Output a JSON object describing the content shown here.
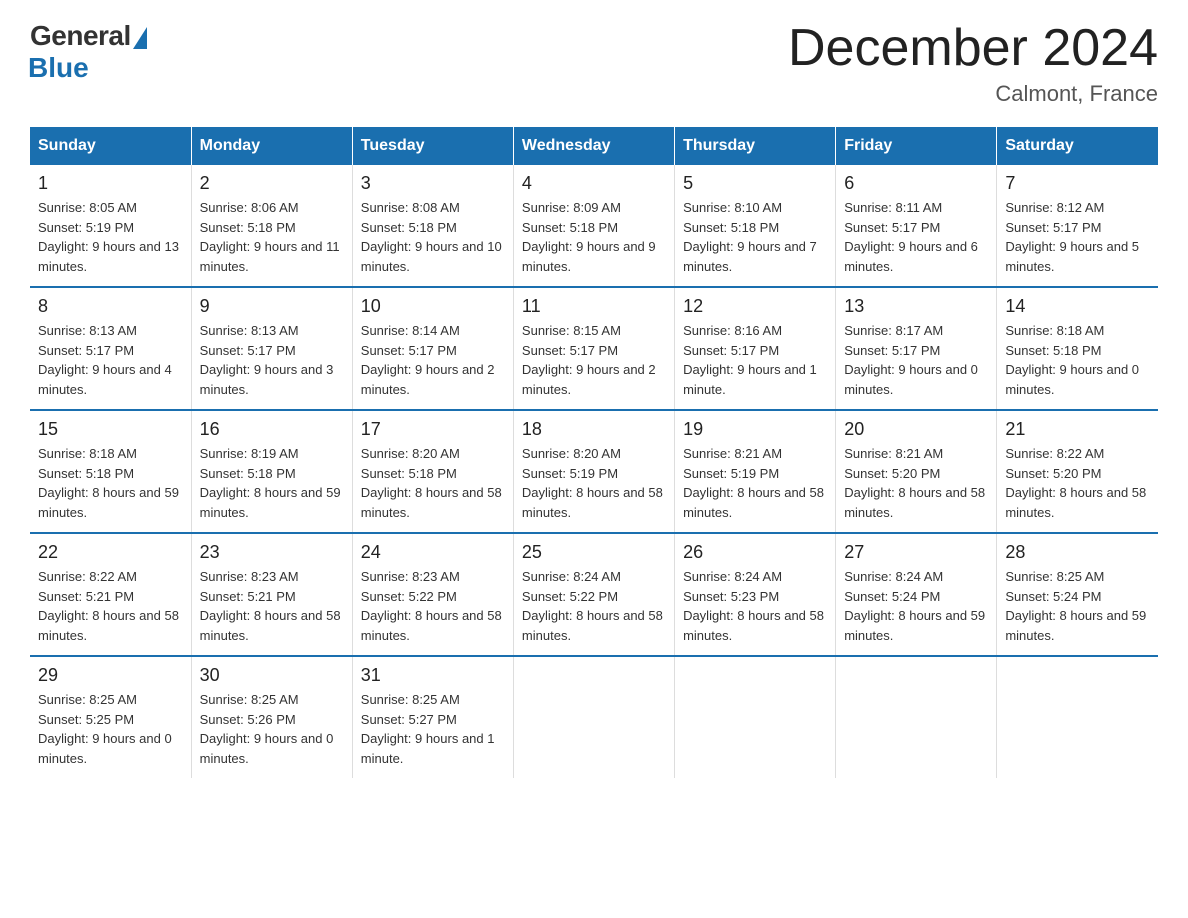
{
  "logo": {
    "general_text": "General",
    "blue_text": "Blue"
  },
  "header": {
    "title": "December 2024",
    "subtitle": "Calmont, France"
  },
  "weekdays": [
    "Sunday",
    "Monday",
    "Tuesday",
    "Wednesday",
    "Thursday",
    "Friday",
    "Saturday"
  ],
  "weeks": [
    [
      {
        "day": "1",
        "sunrise": "8:05 AM",
        "sunset": "5:19 PM",
        "daylight": "9 hours and 13 minutes."
      },
      {
        "day": "2",
        "sunrise": "8:06 AM",
        "sunset": "5:18 PM",
        "daylight": "9 hours and 11 minutes."
      },
      {
        "day": "3",
        "sunrise": "8:08 AM",
        "sunset": "5:18 PM",
        "daylight": "9 hours and 10 minutes."
      },
      {
        "day": "4",
        "sunrise": "8:09 AM",
        "sunset": "5:18 PM",
        "daylight": "9 hours and 9 minutes."
      },
      {
        "day": "5",
        "sunrise": "8:10 AM",
        "sunset": "5:18 PM",
        "daylight": "9 hours and 7 minutes."
      },
      {
        "day": "6",
        "sunrise": "8:11 AM",
        "sunset": "5:17 PM",
        "daylight": "9 hours and 6 minutes."
      },
      {
        "day": "7",
        "sunrise": "8:12 AM",
        "sunset": "5:17 PM",
        "daylight": "9 hours and 5 minutes."
      }
    ],
    [
      {
        "day": "8",
        "sunrise": "8:13 AM",
        "sunset": "5:17 PM",
        "daylight": "9 hours and 4 minutes."
      },
      {
        "day": "9",
        "sunrise": "8:13 AM",
        "sunset": "5:17 PM",
        "daylight": "9 hours and 3 minutes."
      },
      {
        "day": "10",
        "sunrise": "8:14 AM",
        "sunset": "5:17 PM",
        "daylight": "9 hours and 2 minutes."
      },
      {
        "day": "11",
        "sunrise": "8:15 AM",
        "sunset": "5:17 PM",
        "daylight": "9 hours and 2 minutes."
      },
      {
        "day": "12",
        "sunrise": "8:16 AM",
        "sunset": "5:17 PM",
        "daylight": "9 hours and 1 minute."
      },
      {
        "day": "13",
        "sunrise": "8:17 AM",
        "sunset": "5:17 PM",
        "daylight": "9 hours and 0 minutes."
      },
      {
        "day": "14",
        "sunrise": "8:18 AM",
        "sunset": "5:18 PM",
        "daylight": "9 hours and 0 minutes."
      }
    ],
    [
      {
        "day": "15",
        "sunrise": "8:18 AM",
        "sunset": "5:18 PM",
        "daylight": "8 hours and 59 minutes."
      },
      {
        "day": "16",
        "sunrise": "8:19 AM",
        "sunset": "5:18 PM",
        "daylight": "8 hours and 59 minutes."
      },
      {
        "day": "17",
        "sunrise": "8:20 AM",
        "sunset": "5:18 PM",
        "daylight": "8 hours and 58 minutes."
      },
      {
        "day": "18",
        "sunrise": "8:20 AM",
        "sunset": "5:19 PM",
        "daylight": "8 hours and 58 minutes."
      },
      {
        "day": "19",
        "sunrise": "8:21 AM",
        "sunset": "5:19 PM",
        "daylight": "8 hours and 58 minutes."
      },
      {
        "day": "20",
        "sunrise": "8:21 AM",
        "sunset": "5:20 PM",
        "daylight": "8 hours and 58 minutes."
      },
      {
        "day": "21",
        "sunrise": "8:22 AM",
        "sunset": "5:20 PM",
        "daylight": "8 hours and 58 minutes."
      }
    ],
    [
      {
        "day": "22",
        "sunrise": "8:22 AM",
        "sunset": "5:21 PM",
        "daylight": "8 hours and 58 minutes."
      },
      {
        "day": "23",
        "sunrise": "8:23 AM",
        "sunset": "5:21 PM",
        "daylight": "8 hours and 58 minutes."
      },
      {
        "day": "24",
        "sunrise": "8:23 AM",
        "sunset": "5:22 PM",
        "daylight": "8 hours and 58 minutes."
      },
      {
        "day": "25",
        "sunrise": "8:24 AM",
        "sunset": "5:22 PM",
        "daylight": "8 hours and 58 minutes."
      },
      {
        "day": "26",
        "sunrise": "8:24 AM",
        "sunset": "5:23 PM",
        "daylight": "8 hours and 58 minutes."
      },
      {
        "day": "27",
        "sunrise": "8:24 AM",
        "sunset": "5:24 PM",
        "daylight": "8 hours and 59 minutes."
      },
      {
        "day": "28",
        "sunrise": "8:25 AM",
        "sunset": "5:24 PM",
        "daylight": "8 hours and 59 minutes."
      }
    ],
    [
      {
        "day": "29",
        "sunrise": "8:25 AM",
        "sunset": "5:25 PM",
        "daylight": "9 hours and 0 minutes."
      },
      {
        "day": "30",
        "sunrise": "8:25 AM",
        "sunset": "5:26 PM",
        "daylight": "9 hours and 0 minutes."
      },
      {
        "day": "31",
        "sunrise": "8:25 AM",
        "sunset": "5:27 PM",
        "daylight": "9 hours and 1 minute."
      },
      null,
      null,
      null,
      null
    ]
  ]
}
